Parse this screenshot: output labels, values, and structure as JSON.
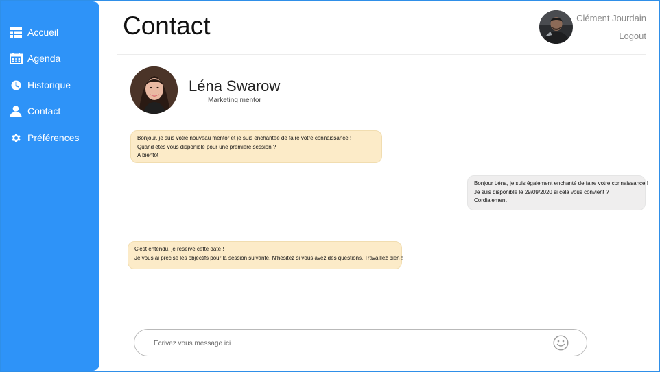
{
  "sidebar": {
    "items": [
      {
        "label": "Accueil",
        "icon": "dashboard-icon"
      },
      {
        "label": "Agenda",
        "icon": "calendar-icon"
      },
      {
        "label": "Historique",
        "icon": "clock-icon"
      },
      {
        "label": "Contact",
        "icon": "user-icon"
      },
      {
        "label": "Préférences",
        "icon": "gear-icon"
      }
    ]
  },
  "header": {
    "title": "Contact",
    "user_name": "Clément Jourdain",
    "logout_label": "Logout"
  },
  "contact": {
    "name": "Léna Swarow",
    "role": "Marketing mentor"
  },
  "messages": [
    {
      "direction": "in",
      "lines": [
        "Bonjour, je suis votre nouveau mentor et je suis enchantée de faire votre connaissance !",
        "Quand êtes vous disponible pour une première session ?",
        "A bientôt"
      ]
    },
    {
      "direction": "out",
      "lines": [
        "Bonjour Léna, je suis également enchanté de faire votre connaissance !",
        "Je suis disponible le 29/09/2020 si cela vous convient ?",
        "Cordialement"
      ]
    },
    {
      "direction": "in",
      "lines": [
        "C'est entendu, je réserve cette date !",
        "Je vous ai précisé les objectifs pour la session suivante. N'hésitez si vous avez des questions. Travaillez bien !"
      ]
    }
  ],
  "composer": {
    "placeholder": "Ecrivez vous message ici",
    "value": ""
  },
  "colors": {
    "sidebar": "#2e93f8",
    "incoming_bubble": "#fcebc8",
    "outgoing_bubble": "#efeeee"
  }
}
